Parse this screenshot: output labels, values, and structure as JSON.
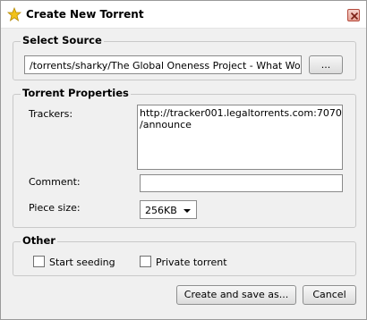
{
  "window": {
    "title": "Create New Torrent",
    "title_icon": "star-icon",
    "close_icon": "close-icon"
  },
  "source": {
    "group_label": "Select Source",
    "path_value": "/torrents/sharky/The Global Oneness Project - What Would It Look Like",
    "browse_label": "..."
  },
  "properties": {
    "group_label": "Torrent Properties",
    "trackers_label": "Trackers:",
    "trackers_lines": [
      "http://tracker001.legaltorrents.com:7070",
      "/announce"
    ],
    "comment_label": "Comment:",
    "comment_value": "",
    "piece_size_label": "Piece size:",
    "piece_size_value": "256KB"
  },
  "other": {
    "group_label": "Other",
    "start_seeding_label": "Start seeding",
    "start_seeding_checked": false,
    "private_label": "Private torrent",
    "private_checked": false
  },
  "buttons": {
    "create_label": "Create and save as...",
    "cancel_label": "Cancel"
  },
  "colors": {
    "window_bg": "#f0f0f0",
    "star": "#f2c21b",
    "close": "#c0392b"
  }
}
